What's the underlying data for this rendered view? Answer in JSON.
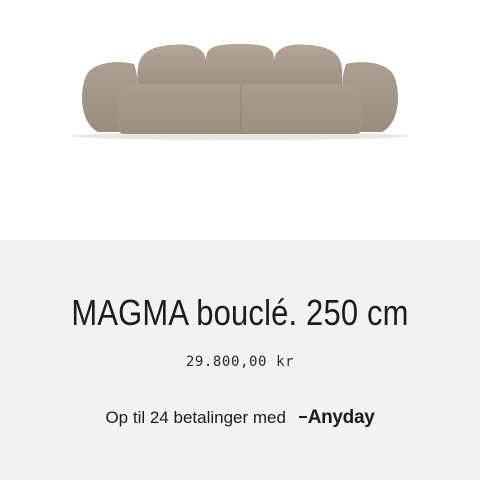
{
  "product": {
    "image_alt": "MAGMA bouclé sofa",
    "title": "MAGMA bouclé. 250 cm",
    "price": "29.800,00 kr"
  },
  "payment": {
    "installments_text": "Op til 24 betalinger med",
    "provider_name": "Anyday"
  },
  "colors": {
    "sofa": "#a89c8d",
    "info_background": "#f2f2f2",
    "text": "#1c1c1c"
  }
}
